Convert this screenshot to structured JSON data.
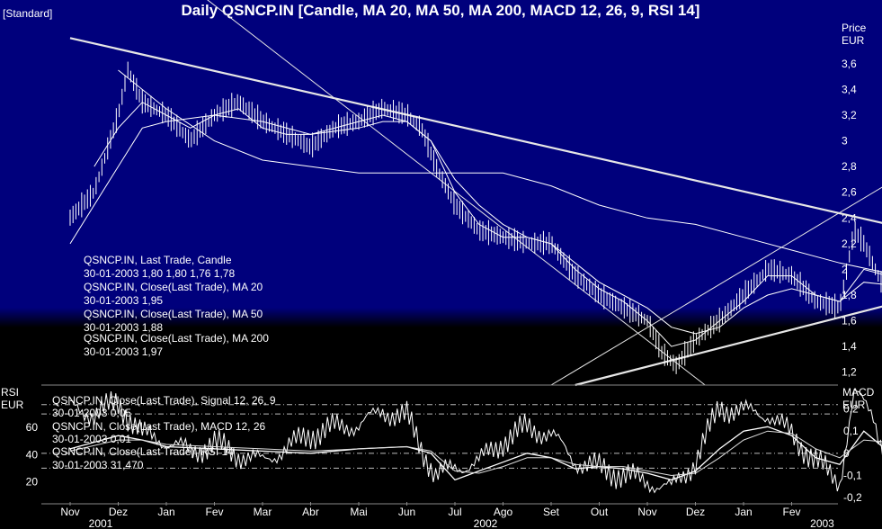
{
  "header": {
    "title": "Daily QSNCP.IN [Candle, MA 20, MA 50, MA 200, MACD 12, 26, 9, RSI 14]",
    "mode": "[Standard]"
  },
  "chart_data": [
    {
      "type": "candlestick",
      "panel": "price",
      "axis_label": "Price",
      "axis_unit": "EUR",
      "ylim": [
        1.1,
        3.9
      ],
      "y_ticks": [
        "3,6",
        "3,4",
        "3,2",
        "3",
        "2,8",
        "2,6",
        "2,4",
        "2,2",
        "2",
        "1,8",
        "1,6",
        "1,4",
        "1,2"
      ],
      "legend": [
        {
          "name": "QSNCP.IN, Last Trade, Candle",
          "value": "30-01-2003 1,80 1,80 1,76 1,78"
        },
        {
          "name": "QSNCP.IN, Close(Last Trade), MA 20",
          "value": "30-01-2003 1,95"
        },
        {
          "name": "QSNCP.IN, Close(Last Trade), MA 50",
          "value": "30-01-2003 1,88"
        },
        {
          "name": "QSNCP.IN, Close(Last Trade), MA 200",
          "value": "30-01-2003 1,97"
        }
      ],
      "close_series": {
        "name": "Close",
        "points": [
          [
            0,
            2.4
          ],
          [
            0.5,
            2.6
          ],
          [
            1,
            3.2
          ],
          [
            1.2,
            3.55
          ],
          [
            1.5,
            3.3
          ],
          [
            2,
            3.2
          ],
          [
            2.5,
            3.0
          ],
          [
            3,
            3.2
          ],
          [
            3.5,
            3.3
          ],
          [
            4,
            3.15
          ],
          [
            4.5,
            3.05
          ],
          [
            5,
            2.95
          ],
          [
            5.5,
            3.1
          ],
          [
            6,
            3.15
          ],
          [
            6.5,
            3.25
          ],
          [
            7,
            3.2
          ],
          [
            7.3,
            3.1
          ],
          [
            7.6,
            2.8
          ],
          [
            8,
            2.5
          ],
          [
            8.5,
            2.3
          ],
          [
            9,
            2.25
          ],
          [
            9.5,
            2.2
          ],
          [
            10,
            2.2
          ],
          [
            10.5,
            1.95
          ],
          [
            11,
            1.8
          ],
          [
            11.5,
            1.7
          ],
          [
            12,
            1.6
          ],
          [
            12.3,
            1.35
          ],
          [
            12.6,
            1.25
          ],
          [
            13,
            1.45
          ],
          [
            13.5,
            1.6
          ],
          [
            14,
            1.8
          ],
          [
            14.5,
            2.0
          ],
          [
            15,
            1.95
          ],
          [
            15.5,
            1.75
          ],
          [
            16,
            1.7
          ],
          [
            16.3,
            2.3
          ],
          [
            16.5,
            2.2
          ],
          [
            16.8,
            1.95
          ],
          [
            17,
            1.78
          ]
        ]
      },
      "ma_series": [
        {
          "name": "MA 20",
          "points": [
            [
              0.5,
              2.8
            ],
            [
              1,
              3.1
            ],
            [
              1.5,
              3.3
            ],
            [
              2,
              3.2
            ],
            [
              2.5,
              3.1
            ],
            [
              3,
              3.2
            ],
            [
              3.5,
              3.25
            ],
            [
              4,
              3.1
            ],
            [
              4.5,
              3.05
            ],
            [
              5,
              3.05
            ],
            [
              5.5,
              3.1
            ],
            [
              6,
              3.15
            ],
            [
              6.5,
              3.2
            ],
            [
              7,
              3.15
            ],
            [
              7.5,
              3.0
            ],
            [
              8,
              2.6
            ],
            [
              8.5,
              2.35
            ],
            [
              9,
              2.25
            ],
            [
              9.5,
              2.25
            ],
            [
              10,
              2.2
            ],
            [
              10.5,
              2.0
            ],
            [
              11,
              1.85
            ],
            [
              11.5,
              1.75
            ],
            [
              12,
              1.6
            ],
            [
              12.5,
              1.4
            ],
            [
              13,
              1.45
            ],
            [
              13.5,
              1.6
            ],
            [
              14,
              1.75
            ],
            [
              14.5,
              1.95
            ],
            [
              15,
              1.95
            ],
            [
              15.5,
              1.8
            ],
            [
              16,
              1.75
            ],
            [
              16.5,
              2.0
            ],
            [
              17,
              1.95
            ]
          ]
        },
        {
          "name": "MA 50",
          "points": [
            [
              0,
              2.2
            ],
            [
              1,
              2.8
            ],
            [
              1.5,
              3.1
            ],
            [
              2,
              3.15
            ],
            [
              3,
              3.2
            ],
            [
              4,
              3.15
            ],
            [
              5,
              3.05
            ],
            [
              6,
              3.1
            ],
            [
              6.5,
              3.15
            ],
            [
              7,
              3.15
            ],
            [
              7.5,
              3.0
            ],
            [
              8,
              2.7
            ],
            [
              8.5,
              2.5
            ],
            [
              9,
              2.35
            ],
            [
              9.5,
              2.25
            ],
            [
              10,
              2.2
            ],
            [
              10.5,
              2.05
            ],
            [
              11,
              1.9
            ],
            [
              11.5,
              1.8
            ],
            [
              12,
              1.7
            ],
            [
              12.5,
              1.55
            ],
            [
              13,
              1.5
            ],
            [
              13.5,
              1.55
            ],
            [
              14,
              1.7
            ],
            [
              14.5,
              1.8
            ],
            [
              15,
              1.85
            ],
            [
              15.5,
              1.8
            ],
            [
              16,
              1.75
            ],
            [
              16.5,
              1.9
            ],
            [
              17,
              1.88
            ]
          ]
        },
        {
          "name": "MA 200",
          "points": [
            [
              1,
              3.55
            ],
            [
              2,
              3.25
            ],
            [
              3,
              3.0
            ],
            [
              4,
              2.85
            ],
            [
              5,
              2.8
            ],
            [
              6,
              2.75
            ],
            [
              7,
              2.75
            ],
            [
              8,
              2.75
            ],
            [
              9,
              2.75
            ],
            [
              10,
              2.65
            ],
            [
              11,
              2.5
            ],
            [
              12,
              2.4
            ],
            [
              13,
              2.35
            ],
            [
              14,
              2.25
            ],
            [
              15,
              2.15
            ],
            [
              16,
              2.05
            ],
            [
              17,
              1.97
            ]
          ]
        }
      ],
      "trend_lines": [
        {
          "from": [
            0,
            3.8
          ],
          "to": [
            17.6,
            2.3
          ]
        },
        {
          "from": [
            10.5,
            1.1
          ],
          "to": [
            17.6,
            1.78
          ]
        },
        {
          "from": [
            10.0,
            1.1
          ],
          "to": [
            17.6,
            2.8
          ]
        },
        {
          "from": [
            2.5,
            4.2
          ],
          "to": [
            13.2,
            1.1
          ]
        }
      ]
    },
    {
      "type": "line",
      "panel": "indicators",
      "left_axis": {
        "label": "RSI",
        "unit": "EUR",
        "ylim": [
          5,
          90
        ],
        "ticks": [
          "60",
          "40",
          "20"
        ]
      },
      "right_axis": {
        "label": "MACD",
        "unit": "EUR",
        "ylim": [
          -0.22,
          0.3
        ],
        "ticks": [
          "0,2",
          "0,1",
          "0",
          "-0,1",
          "-0,2"
        ]
      },
      "legend": [
        {
          "name": "QSNCP.IN, Close(Last Trade), Signal 12, 26, 9",
          "value": "30-01-2003 0,05"
        },
        {
          "name": "QSNCP.IN, Close(Last Trade), MACD 12, 26",
          "value": "30-01-2003 0,01"
        },
        {
          "name": "QSNCP.IN, Close(Last Trade), RSI 14",
          "value": "30-01-2003 31,470"
        }
      ],
      "reference_lines_macd": [
        0.22,
        0.0
      ],
      "reference_lines_rsi": [
        70,
        30
      ],
      "rsi": {
        "name": "RSI 14",
        "points": [
          [
            0,
            75
          ],
          [
            0.5,
            70
          ],
          [
            1,
            78
          ],
          [
            1.5,
            55
          ],
          [
            2,
            50
          ],
          [
            2.5,
            42
          ],
          [
            3,
            48
          ],
          [
            3.5,
            40
          ],
          [
            4,
            35
          ],
          [
            4.5,
            45
          ],
          [
            5,
            55
          ],
          [
            5.5,
            60
          ],
          [
            6,
            62
          ],
          [
            6.5,
            72
          ],
          [
            7,
            68
          ],
          [
            7.3,
            45
          ],
          [
            7.6,
            25
          ],
          [
            8,
            30
          ],
          [
            8.5,
            35
          ],
          [
            9,
            50
          ],
          [
            9.5,
            60
          ],
          [
            10,
            55
          ],
          [
            10.5,
            35
          ],
          [
            11,
            30
          ],
          [
            11.5,
            25
          ],
          [
            12,
            20
          ],
          [
            12.5,
            15
          ],
          [
            13,
            35
          ],
          [
            13.5,
            75
          ],
          [
            14,
            72
          ],
          [
            14.5,
            70
          ],
          [
            15,
            55
          ],
          [
            15.5,
            35
          ],
          [
            16,
            20
          ],
          [
            16.3,
            85
          ],
          [
            16.7,
            70
          ],
          [
            17,
            31.47
          ]
        ]
      },
      "macd": {
        "name": "MACD 12, 26",
        "points": [
          [
            0,
            0.02
          ],
          [
            1,
            0.08
          ],
          [
            1.5,
            0.06
          ],
          [
            2,
            0.03
          ],
          [
            3,
            0.02
          ],
          [
            4,
            0.01
          ],
          [
            5,
            0.0
          ],
          [
            6,
            0.02
          ],
          [
            7,
            0.03
          ],
          [
            7.5,
            0.0
          ],
          [
            8,
            -0.12
          ],
          [
            8.5,
            -0.08
          ],
          [
            9,
            -0.04
          ],
          [
            9.5,
            0.0
          ],
          [
            10,
            -0.02
          ],
          [
            10.5,
            -0.07
          ],
          [
            11,
            -0.06
          ],
          [
            11.5,
            -0.07
          ],
          [
            12,
            -0.09
          ],
          [
            12.5,
            -0.12
          ],
          [
            13,
            -0.08
          ],
          [
            13.5,
            0.02
          ],
          [
            14,
            0.1
          ],
          [
            14.5,
            0.12
          ],
          [
            15,
            0.08
          ],
          [
            15.5,
            -0.02
          ],
          [
            16,
            -0.05
          ],
          [
            16.5,
            0.1
          ],
          [
            17,
            0.01
          ]
        ]
      },
      "signal": {
        "name": "Signal 12, 26, 9",
        "points": [
          [
            0,
            0.01
          ],
          [
            1,
            0.06
          ],
          [
            1.5,
            0.06
          ],
          [
            2,
            0.04
          ],
          [
            3,
            0.03
          ],
          [
            4,
            0.02
          ],
          [
            5,
            0.01
          ],
          [
            6,
            0.02
          ],
          [
            7,
            0.03
          ],
          [
            7.5,
            0.01
          ],
          [
            8,
            -0.08
          ],
          [
            8.5,
            -0.09
          ],
          [
            9,
            -0.06
          ],
          [
            9.5,
            -0.02
          ],
          [
            10,
            -0.02
          ],
          [
            10.5,
            -0.05
          ],
          [
            11,
            -0.06
          ],
          [
            11.5,
            -0.06
          ],
          [
            12,
            -0.08
          ],
          [
            12.5,
            -0.1
          ],
          [
            13,
            -0.09
          ],
          [
            13.5,
            -0.02
          ],
          [
            14,
            0.06
          ],
          [
            14.5,
            0.1
          ],
          [
            15,
            0.09
          ],
          [
            15.5,
            0.02
          ],
          [
            16,
            -0.02
          ],
          [
            16.5,
            0.06
          ],
          [
            17,
            0.05
          ]
        ]
      }
    }
  ],
  "x_axis": {
    "months": [
      "Nov",
      "Dez",
      "Jan",
      "Fev",
      "Mar",
      "Abr",
      "Mai",
      "Jun",
      "Jul",
      "Ago",
      "Set",
      "Out",
      "Nov",
      "Dez",
      "Jan",
      "Fev"
    ],
    "years": [
      {
        "label": "2001",
        "month_index": 0
      },
      {
        "label": "2002",
        "month_index": 8
      },
      {
        "label": "2003",
        "month_index": 15
      }
    ]
  }
}
